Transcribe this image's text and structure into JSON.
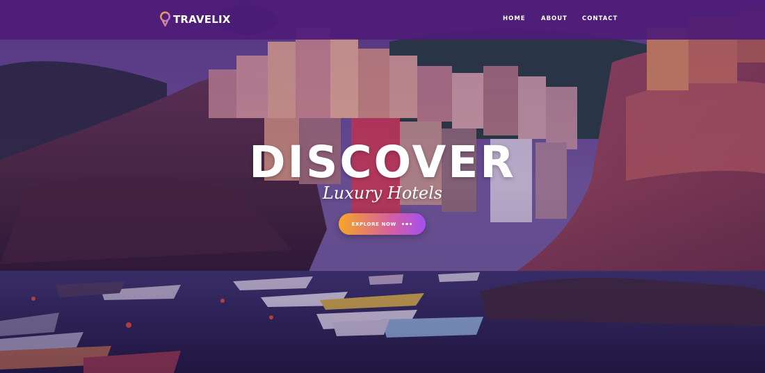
{
  "brand": {
    "name": "TRAVELIX",
    "icon": "map-pin-icon",
    "icon_color": "#b06cf0"
  },
  "nav": {
    "items": [
      {
        "label": "HOME"
      },
      {
        "label": "ABOUT"
      },
      {
        "label": "CONTACT"
      }
    ]
  },
  "hero": {
    "headline": "DISCOVER",
    "subheadline": "Luxury Hotels",
    "cta": {
      "label": "EXPLORE NOW",
      "icon": "more-dots-icon"
    },
    "background": "harbor-village-photo"
  },
  "colors": {
    "navbar": "#4e1c78",
    "cta_start": "#f6a626",
    "cta_end": "#a54ff2",
    "text": "#ffffff"
  }
}
